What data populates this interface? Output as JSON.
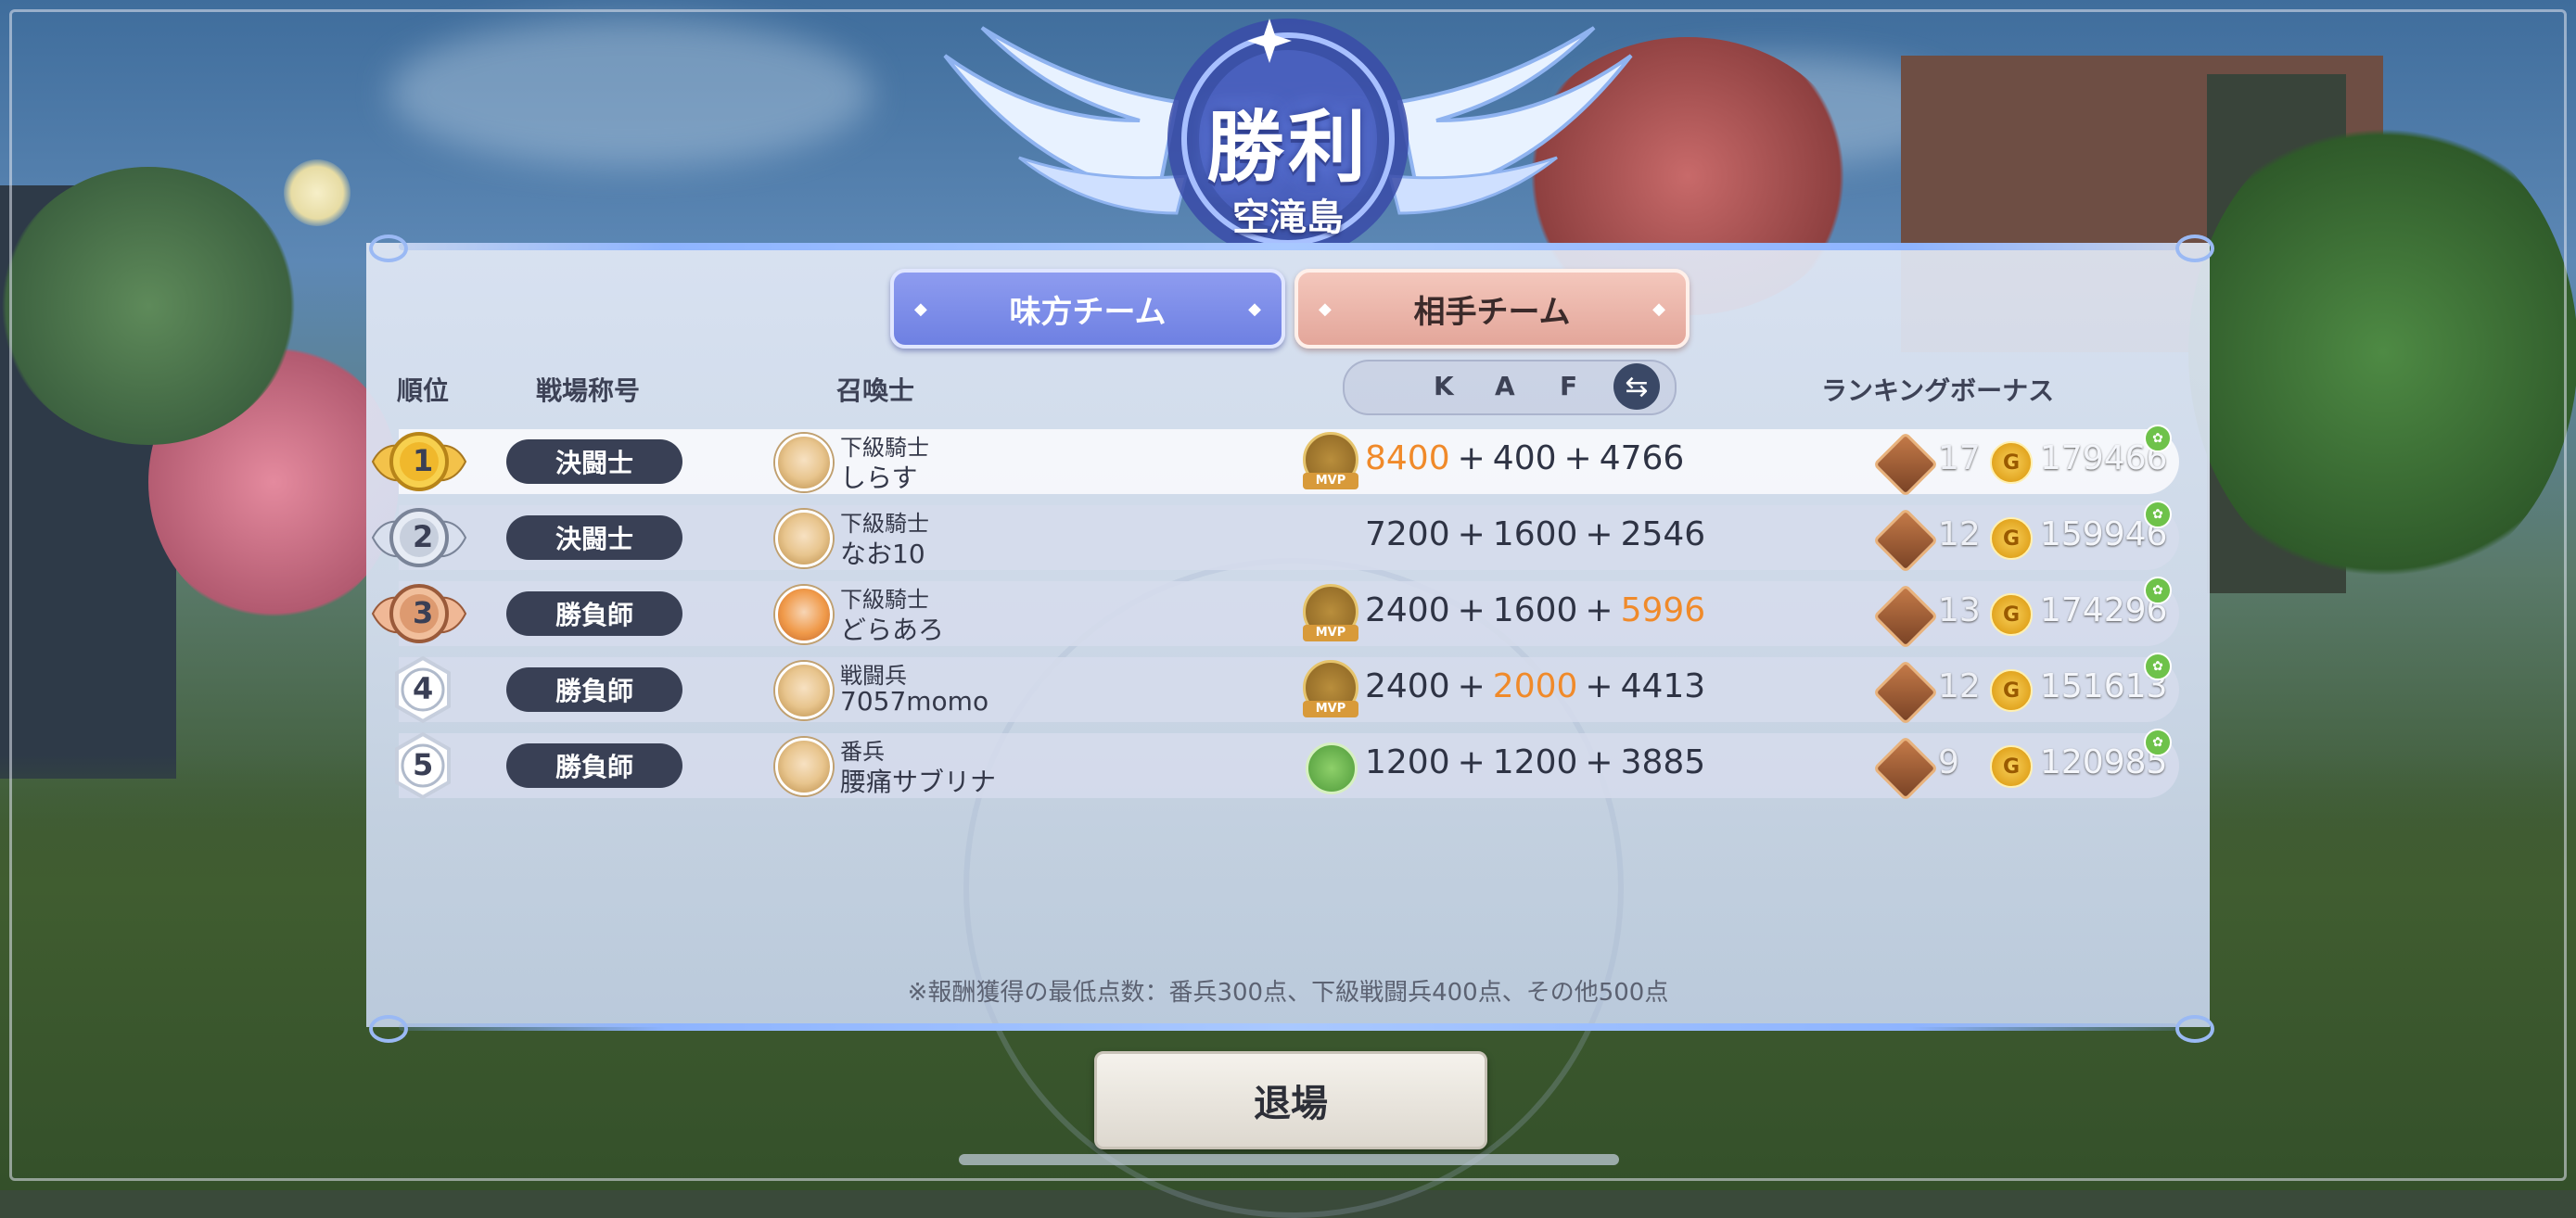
{
  "header": {
    "title": "勝利",
    "stage": "空滝島"
  },
  "tabs": [
    {
      "label": "味方チーム",
      "active": true
    },
    {
      "label": "相手チーム",
      "active": false
    }
  ],
  "columns": {
    "rank": "順位",
    "battle_title": "戦場称号",
    "summoner": "召喚士",
    "kaf": [
      "K",
      "A",
      "F"
    ],
    "bonus": "ランキングボーナス"
  },
  "rows": [
    {
      "rank": "1",
      "title": "決闘士",
      "class": "下級騎士",
      "name": "しらす",
      "icon": "mvp-kill-icon",
      "k": "8400",
      "a": "400",
      "f": "4766",
      "highlight": "k",
      "chests": "17",
      "coins": "179466"
    },
    {
      "rank": "2",
      "title": "決闘士",
      "class": "下級騎士",
      "name": "なお10",
      "icon": "",
      "k": "7200",
      "a": "1600",
      "f": "2546",
      "highlight": "",
      "chests": "12",
      "coins": "159946"
    },
    {
      "rank": "3",
      "title": "勝負師",
      "class": "下級騎士",
      "name": "どらあろ",
      "icon": "mvp-skull-icon",
      "k": "2400",
      "a": "1600",
      "f": "5996",
      "highlight": "f",
      "chests": "13",
      "coins": "174296"
    },
    {
      "rank": "4",
      "title": "勝負師",
      "class": "戦闘兵",
      "name": "7057momo",
      "icon": "mvp-assist-icon",
      "k": "2400",
      "a": "2000",
      "f": "4413",
      "highlight": "a",
      "chests": "12",
      "coins": "151613"
    },
    {
      "rank": "5",
      "title": "勝負師",
      "class": "番兵",
      "name": "腰痛サブリナ",
      "icon": "leaf-icon",
      "k": "1200",
      "a": "1200",
      "f": "3885",
      "highlight": "",
      "chests": "9",
      "coins": "120985"
    }
  ],
  "misc": {
    "mvp_tag": "MVP",
    "coin_glyph": "G",
    "plus": "+"
  },
  "note": "※報酬獲得の最低点数：番兵300点、下級戦闘兵400点、その他500点",
  "exit_button": "退場",
  "colors": {
    "highlight": "#f08a2a",
    "ally_tab": "#7b8ce8",
    "enemy_tab": "#eab4a8",
    "pill": "#394055"
  }
}
